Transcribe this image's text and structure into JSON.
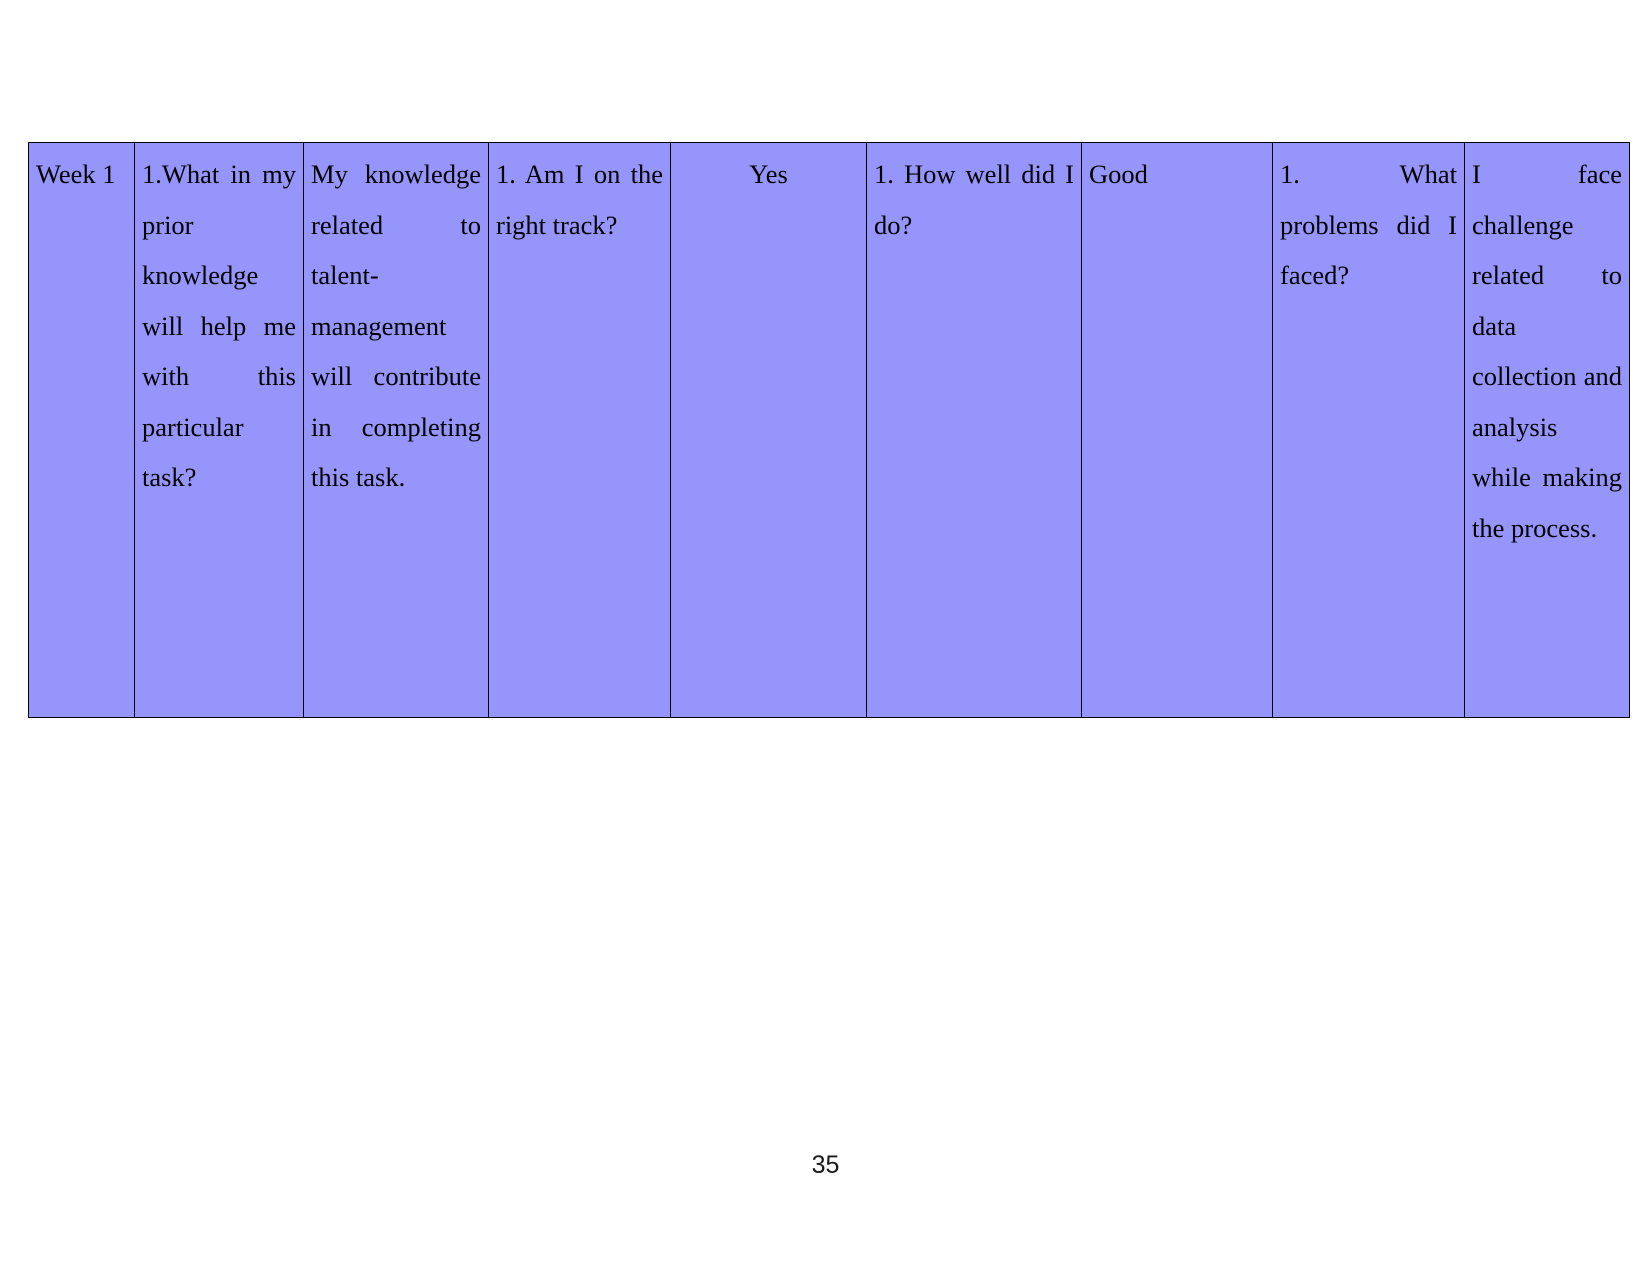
{
  "document": {
    "page_number": "35",
    "table_background_color": "#9595fb",
    "table_border_color": "#000000",
    "text_color": "#000000"
  },
  "table": {
    "name": "weekly-reflection-table",
    "columns": 9,
    "rows": [
      {
        "week_label": "Week 1",
        "cells": [
          {
            "key": "week",
            "align": "left",
            "text": "Week 1"
          },
          {
            "key": "prior_knowledge_q",
            "align": "justify",
            "text": "1.What in my prior knowledge will help me with this particular task?"
          },
          {
            "key": "prior_knowledge_a",
            "align": "justify",
            "text": "My knowledge related to talent-management will contribute in completing this task."
          },
          {
            "key": "on_track_q",
            "align": "justify",
            "text": "1. Am I on the right track?"
          },
          {
            "key": "on_track_a",
            "align": "center",
            "text": "Yes"
          },
          {
            "key": "how_well_q",
            "align": "justify",
            "text": "1. How well did I do?"
          },
          {
            "key": "how_well_a",
            "align": "left",
            "text": "Good"
          },
          {
            "key": "problems_q",
            "align": "justify",
            "text": "1. What problems did I faced?"
          },
          {
            "key": "problems_a",
            "align": "justify",
            "text": "I face challenge related to data collection and analysis while making the process."
          }
        ]
      }
    ]
  }
}
